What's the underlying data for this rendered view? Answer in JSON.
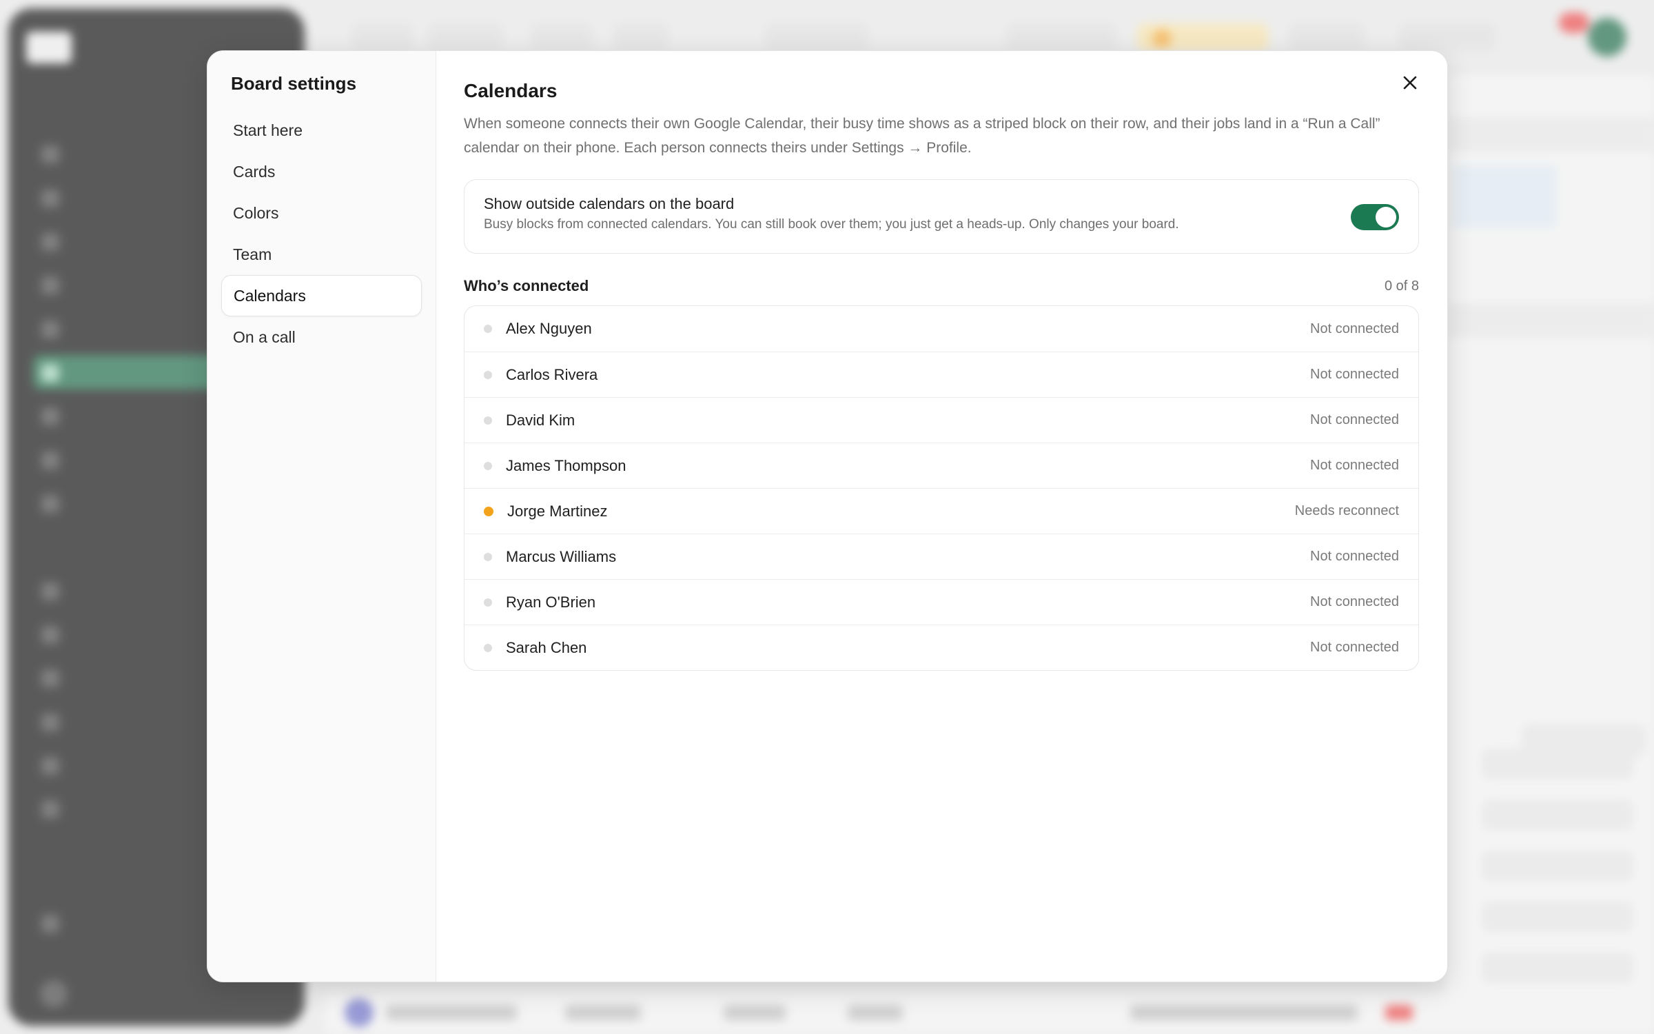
{
  "modal": {
    "title": "Board settings",
    "nav": [
      {
        "label": "Start here",
        "active": false
      },
      {
        "label": "Cards",
        "active": false
      },
      {
        "label": "Colors",
        "active": false
      },
      {
        "label": "Team",
        "active": false
      },
      {
        "label": "Calendars",
        "active": true
      },
      {
        "label": "On a call",
        "active": false
      }
    ]
  },
  "calendars": {
    "title": "Calendars",
    "description": "When someone connects their own Google Calendar, their busy time shows as a striped block on their row, and their jobs land in a “Run a Call” calendar on their phone. Each person connects theirs under Settings → Profile.",
    "toggle": {
      "title": "Show outside calendars on the board",
      "subtitle": "Busy blocks from connected calendars. You can still book over them; you just get a heads-up. Only changes your board.",
      "enabled": true
    },
    "connected": {
      "title": "Who’s connected",
      "count": "0 of 8",
      "people": [
        {
          "name": "Alex Nguyen",
          "status": "Not connected"
        },
        {
          "name": "Carlos Rivera",
          "status": "Not connected"
        },
        {
          "name": "David Kim",
          "status": "Not connected"
        },
        {
          "name": "James Thompson",
          "status": "Not connected"
        },
        {
          "name": "Jorge Martinez",
          "status": "Needs reconnect"
        },
        {
          "name": "Marcus Williams",
          "status": "Not connected"
        },
        {
          "name": "Ryan O'Brien",
          "status": "Not connected"
        },
        {
          "name": "Sarah Chen",
          "status": "Not connected"
        }
      ]
    }
  },
  "colors": {
    "accent": "#1c7a52",
    "warning_dot": "#f2a21b",
    "neutral_dot": "#dedede"
  },
  "icons": {
    "close": "close-icon"
  }
}
